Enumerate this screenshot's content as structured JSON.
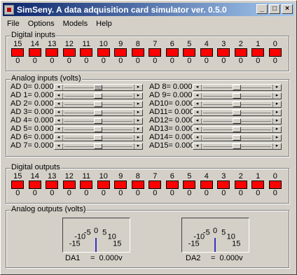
{
  "window": {
    "title": "SimSeny. A data adquisition card simulator ver. 0.5.0",
    "minimize": "_",
    "maximize": "□",
    "close": "×"
  },
  "menu": [
    "File",
    "Options",
    "Models",
    "Help"
  ],
  "digital_inputs": {
    "title": "Digital inputs",
    "bits": [
      "15",
      "14",
      "13",
      "12",
      "11",
      "10",
      "9",
      "8",
      "7",
      "6",
      "5",
      "4",
      "3",
      "2",
      "1",
      "0"
    ],
    "values": [
      "0",
      "0",
      "0",
      "0",
      "0",
      "0",
      "0",
      "0",
      "0",
      "0",
      "0",
      "0",
      "0",
      "0",
      "0",
      "0"
    ]
  },
  "analog_inputs": {
    "title": "Analog inputs (volts)",
    "left": [
      "AD 0= 0.000",
      "AD 1= 0.000",
      "AD 2= 0.000",
      "AD 3= 0.000",
      "AD 4= 0.000",
      "AD 5= 0.000",
      "AD 6= 0.000",
      "AD 7= 0.000"
    ],
    "right": [
      "AD 8= 0.000",
      "AD 9= 0.000",
      "AD10= 0.000",
      "AD11= 0.000",
      "AD12= 0.000",
      "AD13= 0.000",
      "AD14= 0.000",
      "AD15= 0.000"
    ]
  },
  "digital_outputs": {
    "title": "Digital outputs",
    "bits": [
      "15",
      "14",
      "13",
      "12",
      "11",
      "10",
      "9",
      "8",
      "7",
      "6",
      "5",
      "4",
      "3",
      "2",
      "1",
      "0"
    ],
    "values": [
      "0",
      "0",
      "0",
      "0",
      "0",
      "0",
      "0",
      "0",
      "0",
      "0",
      "0",
      "0",
      "0",
      "0",
      "0",
      "0"
    ]
  },
  "analog_outputs": {
    "title": "Analog outputs (volts)",
    "scale": [
      "-15",
      "-10",
      "-5",
      "0",
      "5",
      "10",
      "15"
    ],
    "meters": [
      {
        "label": "DA1",
        "value": "=  0.000v",
        "reading": 0
      },
      {
        "label": "DA2",
        "value": "=  0.000v",
        "reading": 0
      }
    ]
  },
  "led_color": "#ff0000",
  "needle_color": "#0000c0"
}
